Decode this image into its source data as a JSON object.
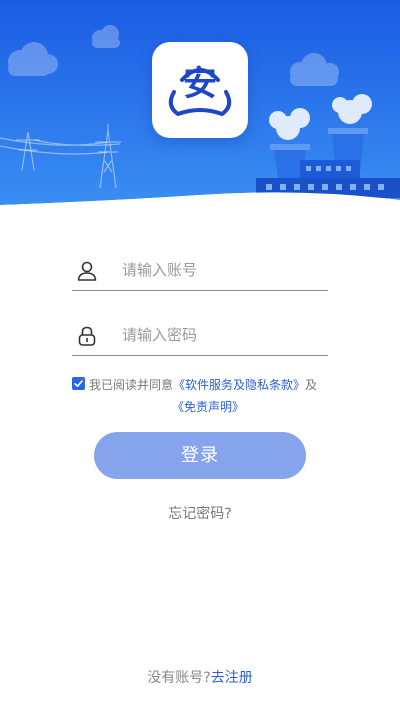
{
  "logo": {
    "char": "安"
  },
  "form": {
    "account_placeholder": "请输入账号",
    "password_placeholder": "请输入密码"
  },
  "agreement": {
    "checked": true,
    "prefix": "我已阅读并同意",
    "terms_link": "《软件服务及隐私条款》",
    "conjunction": "及",
    "disclaimer_link": "《免责声明》"
  },
  "login_label": "登录",
  "forgot_label": "忘记密码?",
  "register": {
    "prompt": "没有账号?",
    "link": "去注册"
  },
  "colors": {
    "primary": "#2c66e0",
    "button": "#86a4ec",
    "header_top": "#1f63e6"
  },
  "icons": [
    "user-icon",
    "lock-icon",
    "check-icon"
  ]
}
